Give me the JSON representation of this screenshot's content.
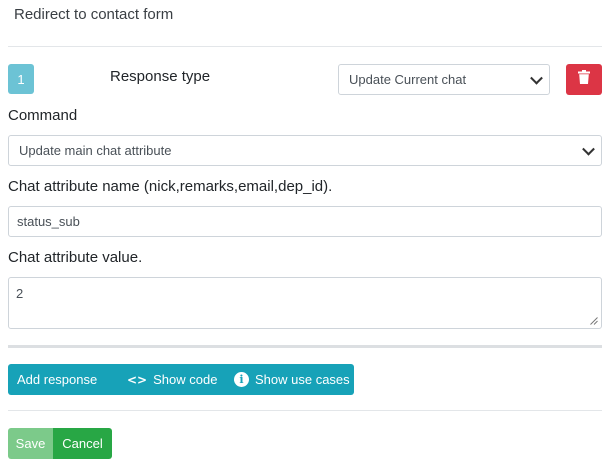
{
  "header": {
    "title": "Redirect to contact form"
  },
  "response": {
    "index": "1",
    "response_type_label": "Response type",
    "response_type_value": "Update Current chat",
    "delete_icon": "trash-icon",
    "command_label": "Command",
    "command_value": "Update main chat attribute",
    "attr_name_label": "Chat attribute name (nick,remarks,email,dep_id).",
    "attr_name_value": "status_sub",
    "attr_value_label": "Chat attribute value.",
    "attr_value_value": "2"
  },
  "toolbar": {
    "add_response": "Add response",
    "show_code": "Show code",
    "show_code_icon": "code-icon",
    "show_use_cases": "Show use cases",
    "show_use_cases_icon": "info-icon"
  },
  "footer": {
    "save": "Save",
    "cancel": "Cancel"
  },
  "colors": {
    "badge": "#6cc3d5",
    "danger": "#dc3545",
    "info": "#17a2b8",
    "success": "#28a745",
    "success_disabled": "#7cca8a"
  }
}
